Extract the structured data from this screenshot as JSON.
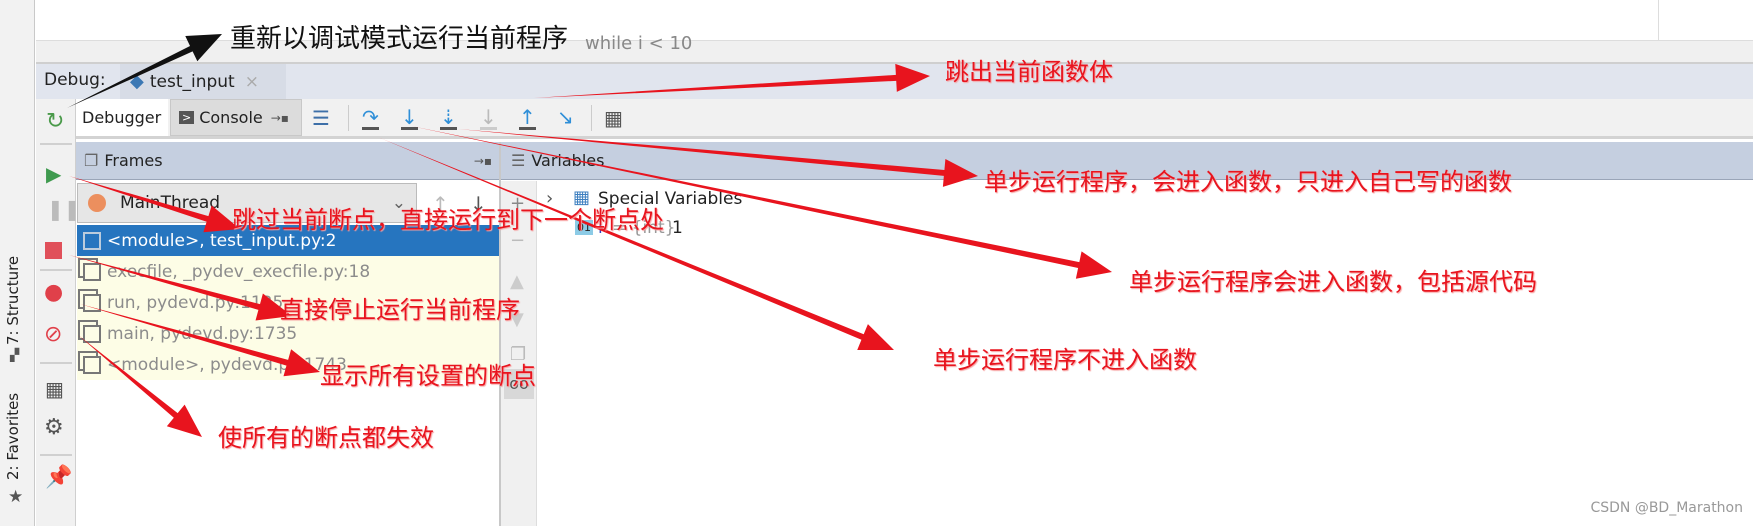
{
  "sidebar": {
    "structure": "7: Structure",
    "favorites": "2: Favorites"
  },
  "editor": {
    "code_hint": "while i < 10"
  },
  "debug": {
    "label": "Debug:",
    "tab": "test_input"
  },
  "tabs": {
    "debugger": "Debugger",
    "console": "Console"
  },
  "frames": {
    "title": "Frames",
    "thread": "MainThread",
    "items": [
      "<module>, test_input.py:2",
      "execfile, _pydev_execfile.py:18",
      "run, pydevd.py:1135",
      "main, pydevd.py:1735",
      "<module>, pydevd.py:1743"
    ]
  },
  "variables": {
    "title": "Variables",
    "special": "Special Variables",
    "var_name": "i",
    "var_type": "= {int}",
    "var_value": "1"
  },
  "annotations": {
    "rerun": "重新以调试模式运行当前程序",
    "step_out": "跳出当前函数体",
    "step_into_my_code": "单步运行程序，会进入函数，只进入自己写的函数",
    "step_into": "单步运行程序会进入函数，包括源代码",
    "step_over": "单步运行程序不进入函数",
    "resume": "跳过当前断点，直接运行到下一个断点处",
    "stop": "直接停止运行当前程序",
    "view_breakpoints": "显示所有设置的断点",
    "mute_breakpoints": "使所有的断点都失效"
  },
  "watermark": "CSDN @BD_Marathon",
  "colors": {
    "selection": "#2675bf",
    "panel_header": "#c5cfe0",
    "annotation": "#e8141e",
    "frame_bg": "#fdfde6"
  }
}
